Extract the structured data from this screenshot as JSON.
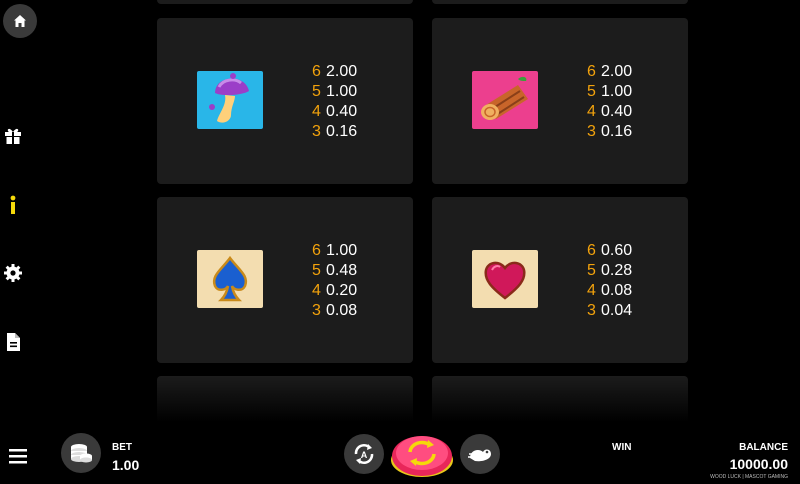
{
  "paytable": [
    {
      "symbol": "mushroom-icon",
      "bg": "#29b6e8",
      "pays": [
        {
          "count": "6",
          "value": "2.00"
        },
        {
          "count": "5",
          "value": "1.00"
        },
        {
          "count": "4",
          "value": "0.40"
        },
        {
          "count": "3",
          "value": "0.16"
        }
      ]
    },
    {
      "symbol": "log-icon",
      "bg": "#ec3f8e",
      "pays": [
        {
          "count": "6",
          "value": "2.00"
        },
        {
          "count": "5",
          "value": "1.00"
        },
        {
          "count": "4",
          "value": "0.40"
        },
        {
          "count": "3",
          "value": "0.16"
        }
      ]
    },
    {
      "symbol": "spade-icon",
      "bg": "#f3ddb0",
      "pays": [
        {
          "count": "6",
          "value": "1.00"
        },
        {
          "count": "5",
          "value": "0.48"
        },
        {
          "count": "4",
          "value": "0.20"
        },
        {
          "count": "3",
          "value": "0.08"
        }
      ]
    },
    {
      "symbol": "heart-icon",
      "bg": "#f3ddb0",
      "pays": [
        {
          "count": "6",
          "value": "0.60"
        },
        {
          "count": "5",
          "value": "0.28"
        },
        {
          "count": "4",
          "value": "0.08"
        },
        {
          "count": "3",
          "value": "0.04"
        }
      ]
    }
  ],
  "bottom_bar": {
    "bet_label": "BET",
    "bet_value": "1.00",
    "win_label": "WIN",
    "balance_label": "BALANCE",
    "balance_value": "10000.00",
    "credit": "WOOD LUCK | MASCOT GAMING"
  },
  "colors": {
    "accent": "#f2a20c",
    "spin": "#e8265a",
    "card_bg": "#1c1c1c",
    "info_icon": "#f5d90a"
  }
}
